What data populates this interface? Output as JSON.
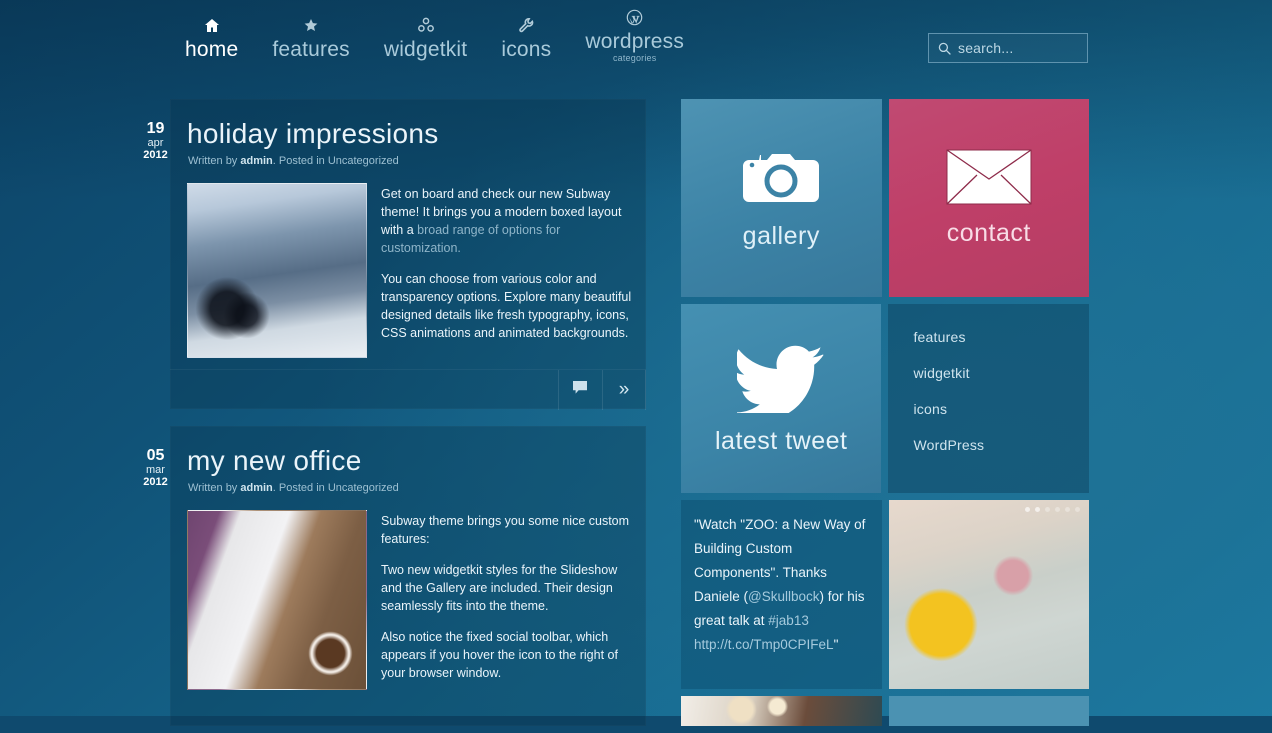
{
  "nav": {
    "items": [
      {
        "label": "home",
        "icon": "home-icon",
        "sub": "",
        "active": true
      },
      {
        "label": "features",
        "icon": "star-icon",
        "sub": "",
        "active": false
      },
      {
        "label": "widgetkit",
        "icon": "widgetkit-icon",
        "sub": "",
        "active": false
      },
      {
        "label": "icons",
        "icon": "wrench-icon",
        "sub": "",
        "active": false
      },
      {
        "label": "wordpress",
        "icon": "wordpress-icon",
        "sub": "categories",
        "active": false
      }
    ]
  },
  "search": {
    "placeholder": "search...",
    "value": "",
    "icon": "search-icon"
  },
  "articles": [
    {
      "day": "19",
      "month": "apr",
      "year": "2012",
      "title": "holiday impressions",
      "meta_prefix": "Written by ",
      "meta_author": "admin",
      "meta_suffix": ". Posted in Uncategorized",
      "image": "mountain-climbers-photo",
      "paragraphs": [
        {
          "plain": "Get on board and check our new Subway theme! It brings you a modern boxed layout with a ",
          "link": "broad range of options for customization.",
          "tail": ""
        },
        {
          "plain": "You can choose from various color and transparency options. Explore many beautiful designed details like fresh typography, icons, CSS animations and animated backgrounds.",
          "link": "",
          "tail": ""
        }
      ],
      "tools": [
        {
          "name": "comment-icon",
          "glyph": ""
        },
        {
          "name": "read-more-icon",
          "glyph": "»"
        }
      ]
    },
    {
      "day": "05",
      "month": "mar",
      "year": "2012",
      "title": "my new office",
      "meta_prefix": "Written by ",
      "meta_author": "admin",
      "meta_suffix": ". Posted in Uncategorized",
      "image": "laptop-desk-photo",
      "paragraphs": [
        {
          "plain": "Subway theme brings you some nice custom features:",
          "link": "",
          "tail": ""
        },
        {
          "plain": "Two new widgetkit styles for the Slideshow and the Gallery are included. Their design seamlessly fits into the theme.",
          "link": "",
          "tail": ""
        },
        {
          "plain": "Also notice the fixed social toolbar, which appears if you hover the icon to the right of your browser window.",
          "link": "",
          "tail": ""
        }
      ],
      "tools": []
    }
  ],
  "tiles": {
    "gallery": {
      "label": "gallery",
      "icon": "camera-icon",
      "color": "#3c83a6"
    },
    "contact": {
      "label": "contact",
      "icon": "envelope-icon",
      "color": "#bf3f68"
    },
    "tweet": {
      "label": "latest tweet",
      "icon": "twitter-bird-icon",
      "color": "#3b84a7"
    },
    "tweet_body": {
      "open_quote": "\"Watch \"ZOO: a New Way of Building Custom Components\". Thanks Daniele (",
      "handle": "@Skullbock",
      "middle": ") for his great talk at ",
      "hashtag": "#jab13",
      "url": "http://t.co/Tmp0CPIFeL",
      "close_quote": "\""
    },
    "links": [
      {
        "label": "features"
      },
      {
        "label": "widgetkit"
      },
      {
        "label": "icons"
      },
      {
        "label": "WordPress"
      }
    ],
    "slideshow": {
      "image": "yellow-vespa-street-photo",
      "dots": [
        true,
        true,
        false,
        false,
        false,
        false
      ]
    },
    "bottom_left": {
      "image": "bokeh-lights-photo"
    },
    "bottom_right": {
      "color": "#4b92b2"
    }
  }
}
